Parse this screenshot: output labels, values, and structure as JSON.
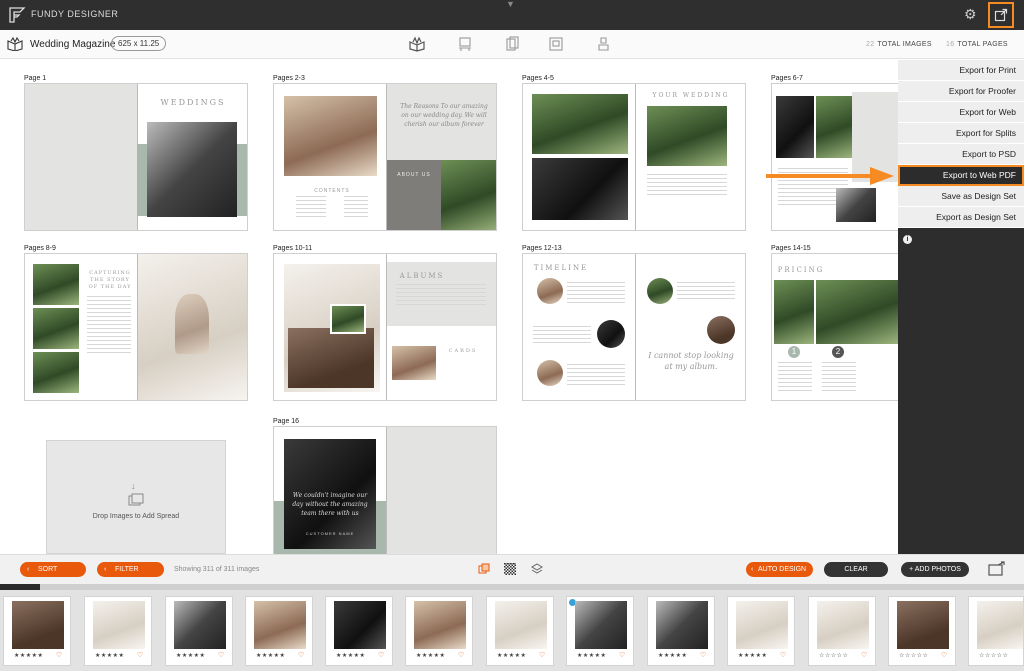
{
  "app": {
    "name": "FUNDY DESIGNER"
  },
  "toolbar": {
    "project_name": "Wedding Magazine",
    "size": "625 x 11.25",
    "total_images_num": "22",
    "total_images_label": "TOTAL IMAGES",
    "total_pages_num": "16",
    "total_pages_label": "TOTAL PAGES"
  },
  "spreads": [
    {
      "label": "Page 1"
    },
    {
      "label": "Pages 2-3"
    },
    {
      "label": "Pages 4-5"
    },
    {
      "label": "Pages 6-7"
    },
    {
      "label": "Pages 8-9"
    },
    {
      "label": "Pages 10-11"
    },
    {
      "label": "Pages 12-13"
    },
    {
      "label": "Pages 14-15"
    },
    {
      "label": "Page 16"
    }
  ],
  "page_text": {
    "weddings": "WEDDINGS",
    "contents": "CONTENTS",
    "about_us": "ABOUT US",
    "your_wedding": "YOUR WEDDING",
    "capturing": "CAPTURING THE STORY OF THE DAY",
    "albums": "ALBUMS",
    "cards": "CARDS",
    "timeline": "TIMELINE",
    "pricing": "PRICING",
    "quote_23": "The Reasons To our amazing on our wedding day. We will cherish our album forever",
    "quote_13": "I cannot stop looking at my album.",
    "quote_16": "We couldn't imagine our day without the amazing team there with us",
    "customer_name": "CUSTOMER NAME",
    "package_1": "1",
    "package_2": "2"
  },
  "dropzone": {
    "text": "Drop Images to Add Spread"
  },
  "export_menu": {
    "items": [
      "Export for Print",
      "Export for Proofer",
      "Export for Web",
      "Export for Splits",
      "Export to PSD",
      "Export to Web PDF",
      "Save as Design Set",
      "Export as Design Set"
    ],
    "active_index": 5,
    "info": "i"
  },
  "actionbar": {
    "sort": "SORT",
    "filter": "FILTER",
    "showing": "Showing 311 of 311 images",
    "auto_design": "AUTO DESIGN",
    "clear": "CLEAR",
    "add_photos": "+ ADD PHOTOS"
  },
  "filmstrip": {
    "rating_filled": "★★★★★",
    "rating_empty": "☆☆☆☆☆",
    "heart": "♡"
  },
  "colors": {
    "accent": "#f58b22",
    "button_orange": "#e8590c",
    "menu_bg": "#eeeeee",
    "dark": "#2d2d2d"
  }
}
